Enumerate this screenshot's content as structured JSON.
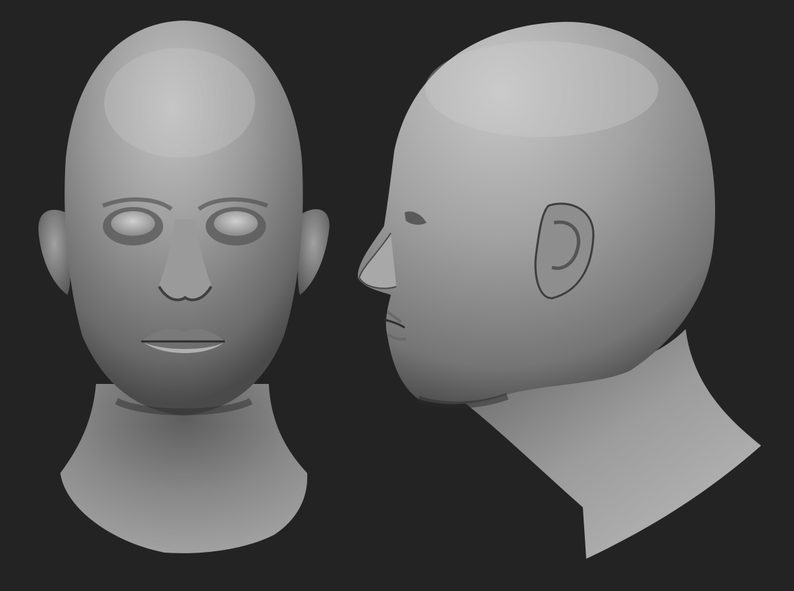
{
  "scene": {
    "background_color": "#232323",
    "clay_color": "#8c8c8c",
    "highlight_color": "#c8c8c8",
    "shadow_color": "#3a3a3a",
    "views": [
      {
        "name": "front-view",
        "label": ""
      },
      {
        "name": "side-view",
        "label": ""
      }
    ]
  }
}
